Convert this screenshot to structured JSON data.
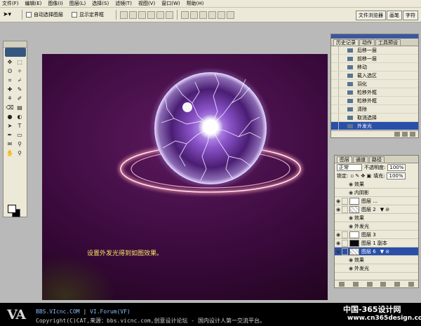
{
  "menu": [
    "文件(F)",
    "编辑(E)",
    "图像(I)",
    "图层(L)",
    "选择(S)",
    "滤镜(T)",
    "视图(V)",
    "窗口(W)",
    "帮助(H)"
  ],
  "options": {
    "auto_select_label": "自动选择图层",
    "bounding_box_label": "显示定界框"
  },
  "dock_tabs": [
    "文件浏览器",
    "画笔",
    "字符"
  ],
  "tools": [
    "move-icon",
    "marquee-icon",
    "lasso-icon",
    "magic-wand-icon",
    "crop-icon",
    "slice-icon",
    "healing-brush-icon",
    "brush-icon",
    "clone-stamp-icon",
    "history-brush-icon",
    "eraser-icon",
    "gradient-icon",
    "blur-icon",
    "dodge-icon",
    "path-select-icon",
    "type-icon",
    "pen-icon",
    "shape-icon",
    "notes-icon",
    "eyedropper-icon",
    "hand-icon",
    "zoom-icon"
  ],
  "tool_glyphs": [
    "✥",
    "⬚",
    "ʘ",
    "✧",
    "⌗",
    "⌿",
    "✚",
    "✎",
    "⚘",
    "✐",
    "⌫",
    "▤",
    "●",
    "◐",
    "➤",
    "T",
    "✒",
    "▭",
    "✉",
    "⚲",
    "✋",
    "⚲"
  ],
  "canvas": {
    "caption": "设置外发光得到如图效果。"
  },
  "history": {
    "tabs": [
      "历史记录",
      "动作",
      "工具预设"
    ],
    "items": [
      "后移一层",
      "前移一层",
      "移动",
      "载入选区",
      "羽化",
      "粒移外框",
      "粒移外框",
      "清除",
      "取消选择",
      "外发光"
    ],
    "selected_index": 9
  },
  "layers": {
    "tabs": [
      "图层",
      "通道",
      "路径"
    ],
    "blend_mode": "正常",
    "opacity_label": "不透明度:",
    "opacity_value": "100%",
    "lock_label": "锁定:",
    "fill_label": "填充:",
    "fill_value": "100%",
    "rows": [
      {
        "label": "效果",
        "kind": "effect-header"
      },
      {
        "label": "内阴影",
        "kind": "effect"
      },
      {
        "label": "图层 ...",
        "kind": "layer",
        "thumb": "mask"
      },
      {
        "label": "图层 2",
        "kind": "layer",
        "thumb": "checker",
        "fx": "▼ ⊘"
      },
      {
        "label": "效果",
        "kind": "effect-header"
      },
      {
        "label": "外发光",
        "kind": "effect"
      },
      {
        "label": "图层 3",
        "kind": "layer",
        "thumb": "mask"
      },
      {
        "label": "图层 1 副本",
        "kind": "layer",
        "thumb": "dark"
      },
      {
        "label": "图层 6",
        "kind": "layer",
        "thumb": "checker",
        "fx": "▼ ⊘"
      },
      {
        "label": "效果",
        "kind": "effect-header"
      },
      {
        "label": "外发光",
        "kind": "effect"
      }
    ],
    "selected_index": 8
  },
  "footer": {
    "logo": "VA",
    "line1_a": "BBS.VIcnc.COM",
    "line1_sep": " | ",
    "line1_b": "VI.Forum(VF)",
    "line2": "Copyright(C)CAT,来源：bbs.vicnc.com,创意设计论坛 - 国内设计人第一交流平台。",
    "wm1": "中国-365设计网",
    "wm2": "www.cn365design.com"
  }
}
